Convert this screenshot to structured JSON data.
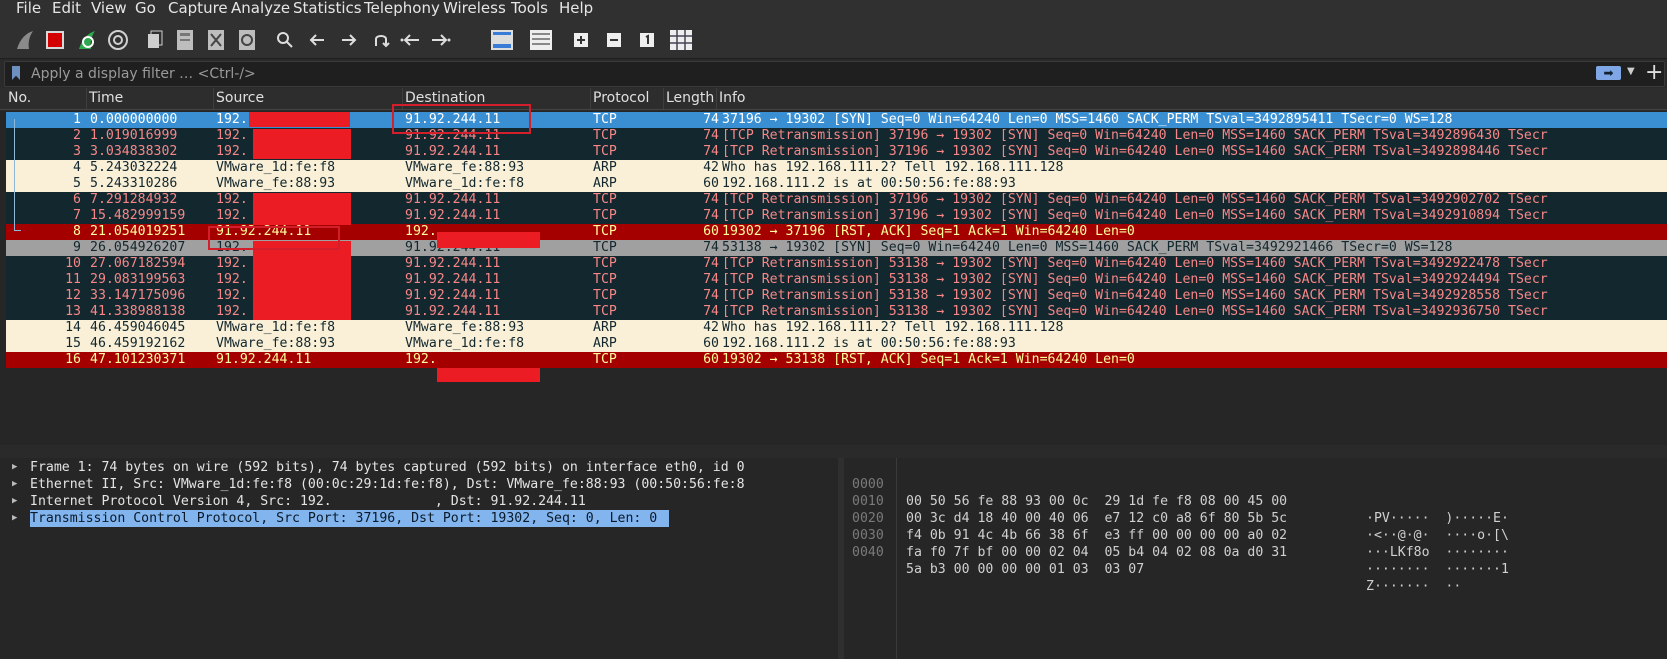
{
  "menu": [
    "File",
    "Edit",
    "View",
    "Go",
    "Capture",
    "Analyze",
    "Statistics",
    "Telephony",
    "Wireless",
    "Tools",
    "Help"
  ],
  "toolbar": {
    "icons": [
      "shark-fin-start-icon",
      "stop-capture-icon",
      "restart-capture-icon",
      "capture-options-icon",
      "open-file-icon",
      "save-file-icon",
      "close-file-icon",
      "reload-file-icon",
      "find-packet-icon",
      "go-back-icon",
      "go-forward-icon",
      "go-to-packet-icon",
      "first-packet-icon",
      "last-packet-icon",
      "auto-scroll-icon",
      "colorize-icon",
      "zoom-in-icon",
      "zoom-out-icon",
      "normal-size-icon",
      "resize-columns-icon"
    ]
  },
  "filter": {
    "placeholder": "Apply a display filter … <Ctrl-/>"
  },
  "columns": [
    "No.",
    "Time",
    "Source",
    "Destination",
    "Protocol",
    "Length",
    "Info"
  ],
  "packets": [
    {
      "no": "1",
      "time": "0.000000000",
      "src": "192.",
      "dst": "91.92.244.11",
      "proto": "TCP",
      "len": "74",
      "info": "37196 → 19302 [SYN] Seq=0 Win=64240 Len=0 MSS=1460 SACK_PERM TSval=3492895411 TSecr=0 WS=128",
      "style": "sel"
    },
    {
      "no": "2",
      "time": "1.019016999",
      "src": "192.",
      "dst": "91.92.244.11",
      "proto": "TCP",
      "len": "74",
      "info": "[TCP Retransmission] 37196 → 19302 [SYN] Seq=0 Win=64240 Len=0 MSS=1460 SACK_PERM TSval=3492896430 TSecr",
      "style": "tcp"
    },
    {
      "no": "3",
      "time": "3.034838302",
      "src": "192.",
      "dst": "91.92.244.11",
      "proto": "TCP",
      "len": "74",
      "info": "[TCP Retransmission] 37196 → 19302 [SYN] Seq=0 Win=64240 Len=0 MSS=1460 SACK_PERM TSval=3492898446 TSecr",
      "style": "tcp"
    },
    {
      "no": "4",
      "time": "5.243032224",
      "src": "VMware_1d:fe:f8",
      "dst": "VMware_fe:88:93",
      "proto": "ARP",
      "len": "42",
      "info": "Who has 192.168.111.2? Tell 192.168.111.128",
      "style": "arp"
    },
    {
      "no": "5",
      "time": "5.243310286",
      "src": "VMware_fe:88:93",
      "dst": "VMware_1d:fe:f8",
      "proto": "ARP",
      "len": "60",
      "info": "192.168.111.2 is at 00:50:56:fe:88:93",
      "style": "arp"
    },
    {
      "no": "6",
      "time": "7.291284932",
      "src": "192.",
      "dst": "91.92.244.11",
      "proto": "TCP",
      "len": "74",
      "info": "[TCP Retransmission] 37196 → 19302 [SYN] Seq=0 Win=64240 Len=0 MSS=1460 SACK_PERM TSval=3492902702 TSecr",
      "style": "tcp"
    },
    {
      "no": "7",
      "time": "15.482999159",
      "src": "192.",
      "dst": "91.92.244.11",
      "proto": "TCP",
      "len": "74",
      "info": "[TCP Retransmission] 37196 → 19302 [SYN] Seq=0 Win=64240 Len=0 MSS=1460 SACK_PERM TSval=3492910894 TSecr",
      "style": "tcp"
    },
    {
      "no": "8",
      "time": "21.054019251",
      "src": "91.92.244.11",
      "dst": "192.",
      "proto": "TCP",
      "len": "60",
      "info": "19302 → 37196 [RST, ACK] Seq=1 Ack=1 Win=64240 Len=0",
      "style": "rst"
    },
    {
      "no": "9",
      "time": "26.054926207",
      "src": "192.",
      "dst": "91.92.244.11",
      "proto": "TCP",
      "len": "74",
      "info": "53138 → 19302 [SYN] Seq=0 Win=64240 Len=0 MSS=1460 SACK_PERM TSval=3492921466 TSecr=0 WS=128",
      "style": "gray"
    },
    {
      "no": "10",
      "time": "27.067182594",
      "src": "192.",
      "dst": "91.92.244.11",
      "proto": "TCP",
      "len": "74",
      "info": "[TCP Retransmission] 53138 → 19302 [SYN] Seq=0 Win=64240 Len=0 MSS=1460 SACK_PERM TSval=3492922478 TSecr",
      "style": "tcp"
    },
    {
      "no": "11",
      "time": "29.083199563",
      "src": "192.",
      "dst": "91.92.244.11",
      "proto": "TCP",
      "len": "74",
      "info": "[TCP Retransmission] 53138 → 19302 [SYN] Seq=0 Win=64240 Len=0 MSS=1460 SACK_PERM TSval=3492924494 TSecr",
      "style": "tcp"
    },
    {
      "no": "12",
      "time": "33.147175096",
      "src": "192.",
      "dst": "91.92.244.11",
      "proto": "TCP",
      "len": "74",
      "info": "[TCP Retransmission] 53138 → 19302 [SYN] Seq=0 Win=64240 Len=0 MSS=1460 SACK_PERM TSval=3492928558 TSecr",
      "style": "tcp"
    },
    {
      "no": "13",
      "time": "41.338988138",
      "src": "192.",
      "dst": "91.92.244.11",
      "proto": "TCP",
      "len": "74",
      "info": "[TCP Retransmission] 53138 → 19302 [SYN] Seq=0 Win=64240 Len=0 MSS=1460 SACK_PERM TSval=3492936750 TSecr",
      "style": "tcp"
    },
    {
      "no": "14",
      "time": "46.459046045",
      "src": "VMware_1d:fe:f8",
      "dst": "VMware_fe:88:93",
      "proto": "ARP",
      "len": "42",
      "info": "Who has 192.168.111.2? Tell 192.168.111.128",
      "style": "arp"
    },
    {
      "no": "15",
      "time": "46.459192162",
      "src": "VMware_fe:88:93",
      "dst": "VMware_1d:fe:f8",
      "proto": "ARP",
      "len": "60",
      "info": "192.168.111.2 is at 00:50:56:fe:88:93",
      "style": "arp"
    },
    {
      "no": "16",
      "time": "47.101230371",
      "src": "91.92.244.11",
      "dst": "192.",
      "proto": "TCP",
      "len": "60",
      "info": "19302 → 53138 [RST, ACK] Seq=1 Ack=1 Win=64240 Len=0",
      "style": "rst"
    }
  ],
  "details": [
    {
      "text": "Frame 1: 74 bytes on wire (592 bits), 74 bytes captured (592 bits) on interface eth0, id 0",
      "selected": false
    },
    {
      "text": "Ethernet II, Src: VMware_1d:fe:f8 (00:0c:29:1d:fe:f8), Dst: VMware_fe:88:93 (00:50:56:fe:8",
      "selected": false
    },
    {
      "text": "Internet Protocol Version 4, Src: 192.             , Dst: 91.92.244.11",
      "selected": false
    },
    {
      "text": "Transmission Control Protocol, Src Port: 37196, Dst Port: 19302, Seq: 0, Len: 0",
      "selected": true
    }
  ],
  "bytes": [
    {
      "off": "0000",
      "hex": "00 50 56 fe 88 93 00 0c  29 1d fe f8 08 00 45 00",
      "ascii": "·PV·····  )·····E·"
    },
    {
      "off": "0010",
      "hex": "00 3c d4 18 40 00 40 06  e7 12 c0 a8 6f 80 5b 5c",
      "ascii": "·<··@·@·  ····o·[\\"
    },
    {
      "off": "0020",
      "hex": "f4 0b 91 4c 4b 66 38 6f  e3 ff 00 00 00 00 a0 02",
      "ascii": "···LKf8o  ········"
    },
    {
      "off": "0030",
      "hex": "fa f0 7f bf 00 00 02 04  05 b4 04 02 08 0a d0 31",
      "ascii": "········  ·······1"
    },
    {
      "off": "0040",
      "hex": "5a b3 00 00 00 00 01 03  03 07",
      "ascii": "Z·······  ··"
    }
  ],
  "colors": {
    "selected": "#3a8fd2",
    "tcp_bg": "#12272e",
    "tcp_fg": "#f78787",
    "arp_bg": "#faf0d7",
    "rst_bg": "#a40000",
    "rst_fg": "#fffc9c",
    "redaction": "#ec1c24",
    "annotation_box": "#d21f2b"
  }
}
